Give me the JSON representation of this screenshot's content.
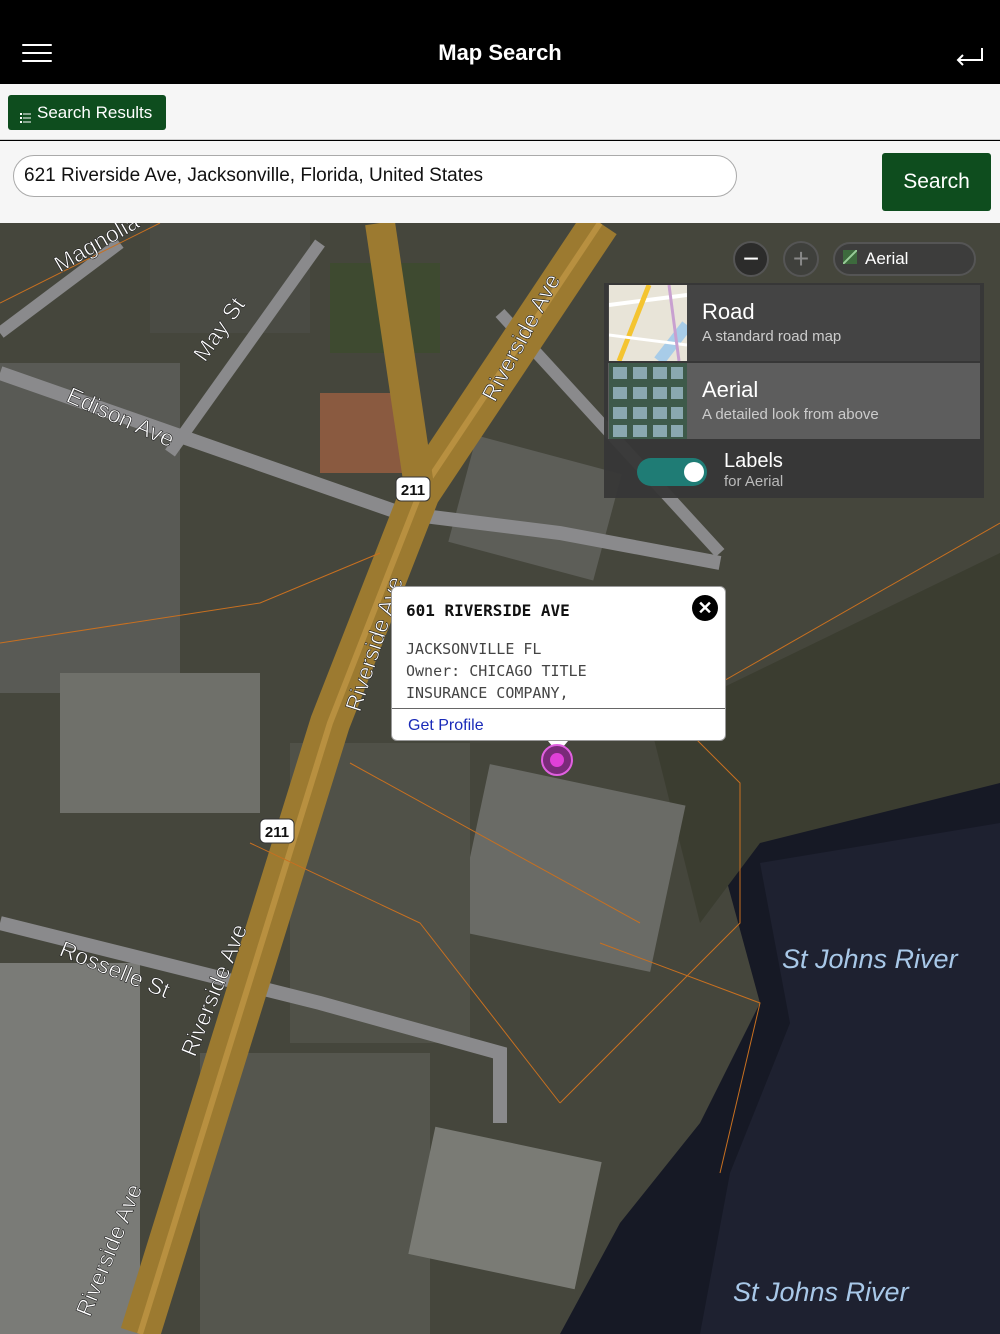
{
  "header": {
    "title": "Map Search",
    "menu_icon": "hamburger-icon",
    "back_icon": "return-arrow-icon"
  },
  "toolbar": {
    "results_label": "Search Results",
    "results_icon": "list-icon"
  },
  "search": {
    "value": "621 Riverside Ave, Jacksonville, Florida, United States",
    "button_label": "Search"
  },
  "map": {
    "zoom_out_label": "−",
    "zoom_in_label": "+",
    "style_selected": "Aerial",
    "style_options": [
      {
        "title": "Road",
        "subtitle": "A standard road map"
      },
      {
        "title": "Aerial",
        "subtitle": "A detailed look from above"
      }
    ],
    "labels_toggle": {
      "title": "Labels",
      "subtitle": "for Aerial",
      "on": true
    },
    "street_labels": [
      "Magnolia",
      "May St",
      "Edison Ave",
      "Riverside Ave",
      "Riverside Ave",
      "Riverside Ave",
      "Riverside Ave",
      "Rosselle St",
      "211",
      "211",
      "St Johns River",
      "St Johns River"
    ],
    "accent_color": "#0e4d1e",
    "toggle_color": "#1f7c75"
  },
  "popup": {
    "title": "601 RIVERSIDE AVE",
    "city": "JACKSONVILLE FL",
    "owner_line1": "Owner: CHICAGO TITLE",
    "owner_line2": "INSURANCE COMPANY,",
    "link_label": "Get Profile",
    "close_label": "✕"
  }
}
